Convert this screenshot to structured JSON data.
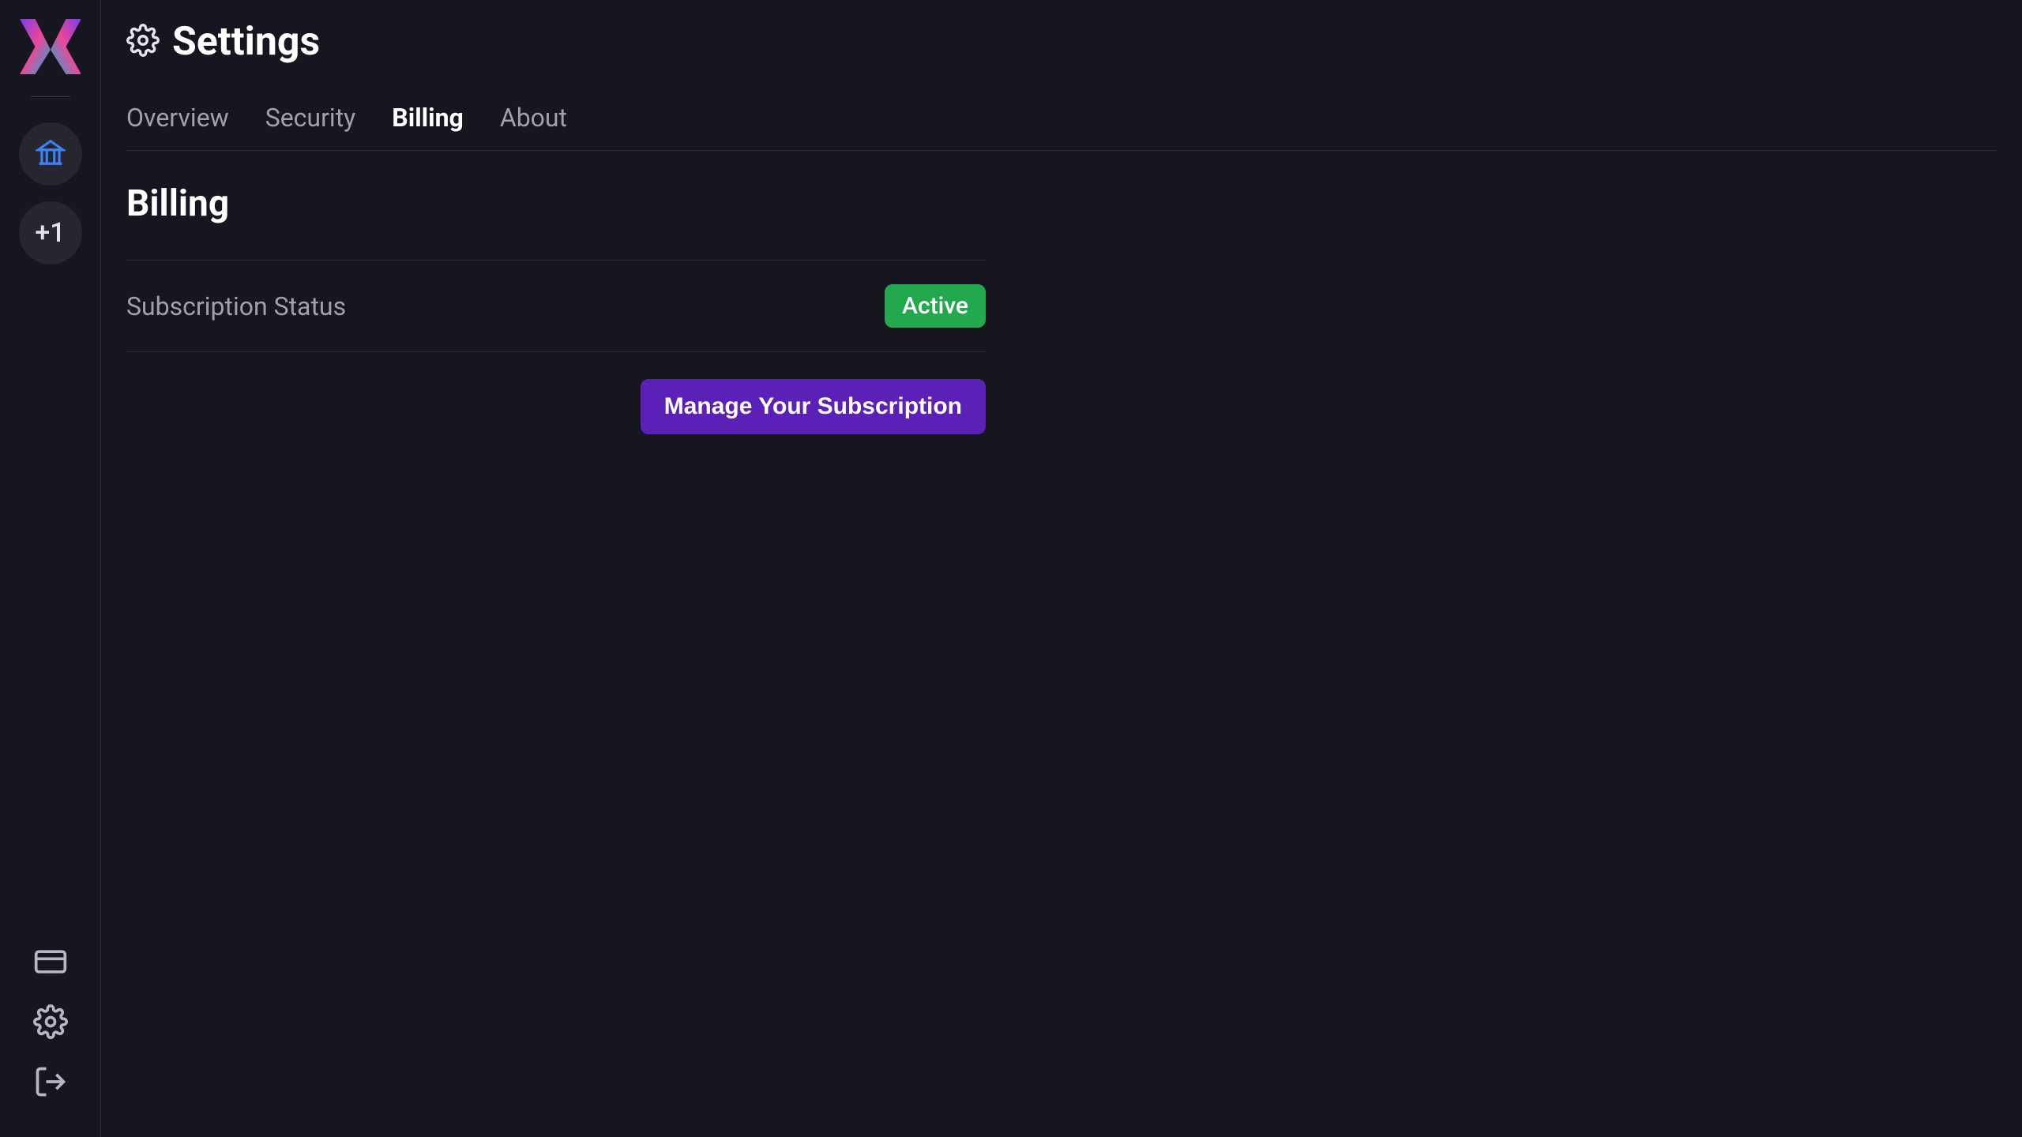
{
  "page": {
    "title": "Settings"
  },
  "sidebar": {
    "add_label": "+1"
  },
  "tabs": [
    {
      "label": "Overview",
      "active": false
    },
    {
      "label": "Security",
      "active": false
    },
    {
      "label": "Billing",
      "active": true
    },
    {
      "label": "About",
      "active": false
    }
  ],
  "billing": {
    "section_title": "Billing",
    "status_label": "Subscription Status",
    "status_value": "Active",
    "manage_button": "Manage Your Subscription"
  }
}
